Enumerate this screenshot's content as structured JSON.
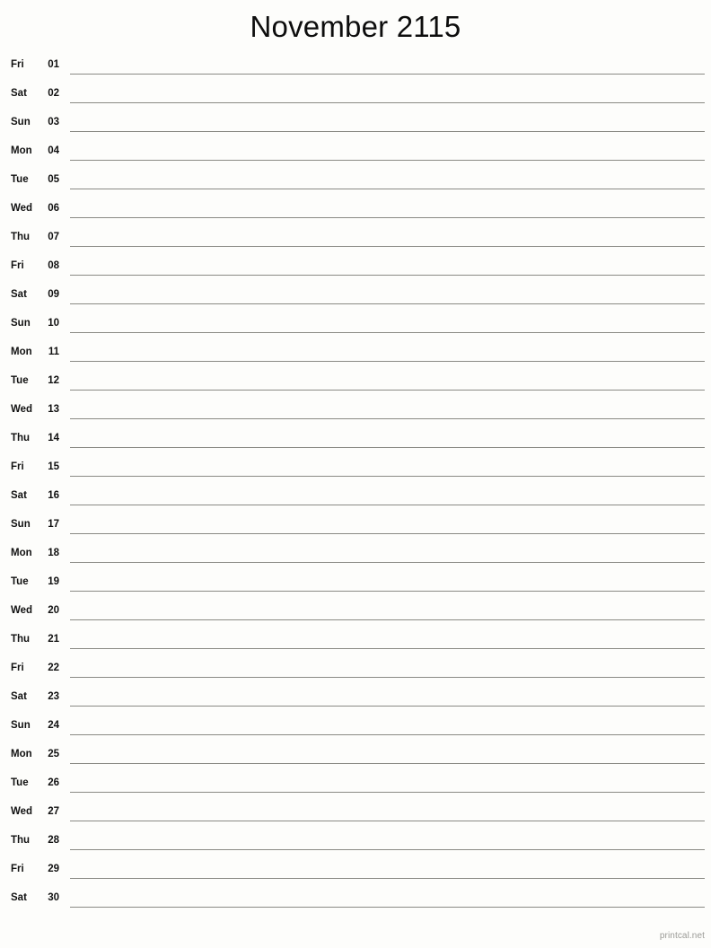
{
  "page": {
    "title": "November 2115",
    "background_color": "#fdfdfb",
    "line_color": "#8a8a84",
    "text_color": "#111111"
  },
  "calendar": {
    "month": "November",
    "year": "2115",
    "days": [
      {
        "weekday": "Fri",
        "date": "01"
      },
      {
        "weekday": "Sat",
        "date": "02"
      },
      {
        "weekday": "Sun",
        "date": "03"
      },
      {
        "weekday": "Mon",
        "date": "04"
      },
      {
        "weekday": "Tue",
        "date": "05"
      },
      {
        "weekday": "Wed",
        "date": "06"
      },
      {
        "weekday": "Thu",
        "date": "07"
      },
      {
        "weekday": "Fri",
        "date": "08"
      },
      {
        "weekday": "Sat",
        "date": "09"
      },
      {
        "weekday": "Sun",
        "date": "10"
      },
      {
        "weekday": "Mon",
        "date": "11"
      },
      {
        "weekday": "Tue",
        "date": "12"
      },
      {
        "weekday": "Wed",
        "date": "13"
      },
      {
        "weekday": "Thu",
        "date": "14"
      },
      {
        "weekday": "Fri",
        "date": "15"
      },
      {
        "weekday": "Sat",
        "date": "16"
      },
      {
        "weekday": "Sun",
        "date": "17"
      },
      {
        "weekday": "Mon",
        "date": "18"
      },
      {
        "weekday": "Tue",
        "date": "19"
      },
      {
        "weekday": "Wed",
        "date": "20"
      },
      {
        "weekday": "Thu",
        "date": "21"
      },
      {
        "weekday": "Fri",
        "date": "22"
      },
      {
        "weekday": "Sat",
        "date": "23"
      },
      {
        "weekday": "Sun",
        "date": "24"
      },
      {
        "weekday": "Mon",
        "date": "25"
      },
      {
        "weekday": "Tue",
        "date": "26"
      },
      {
        "weekday": "Wed",
        "date": "27"
      },
      {
        "weekday": "Thu",
        "date": "28"
      },
      {
        "weekday": "Fri",
        "date": "29"
      },
      {
        "weekday": "Sat",
        "date": "30"
      }
    ]
  },
  "footer": {
    "credit": "printcal.net"
  }
}
